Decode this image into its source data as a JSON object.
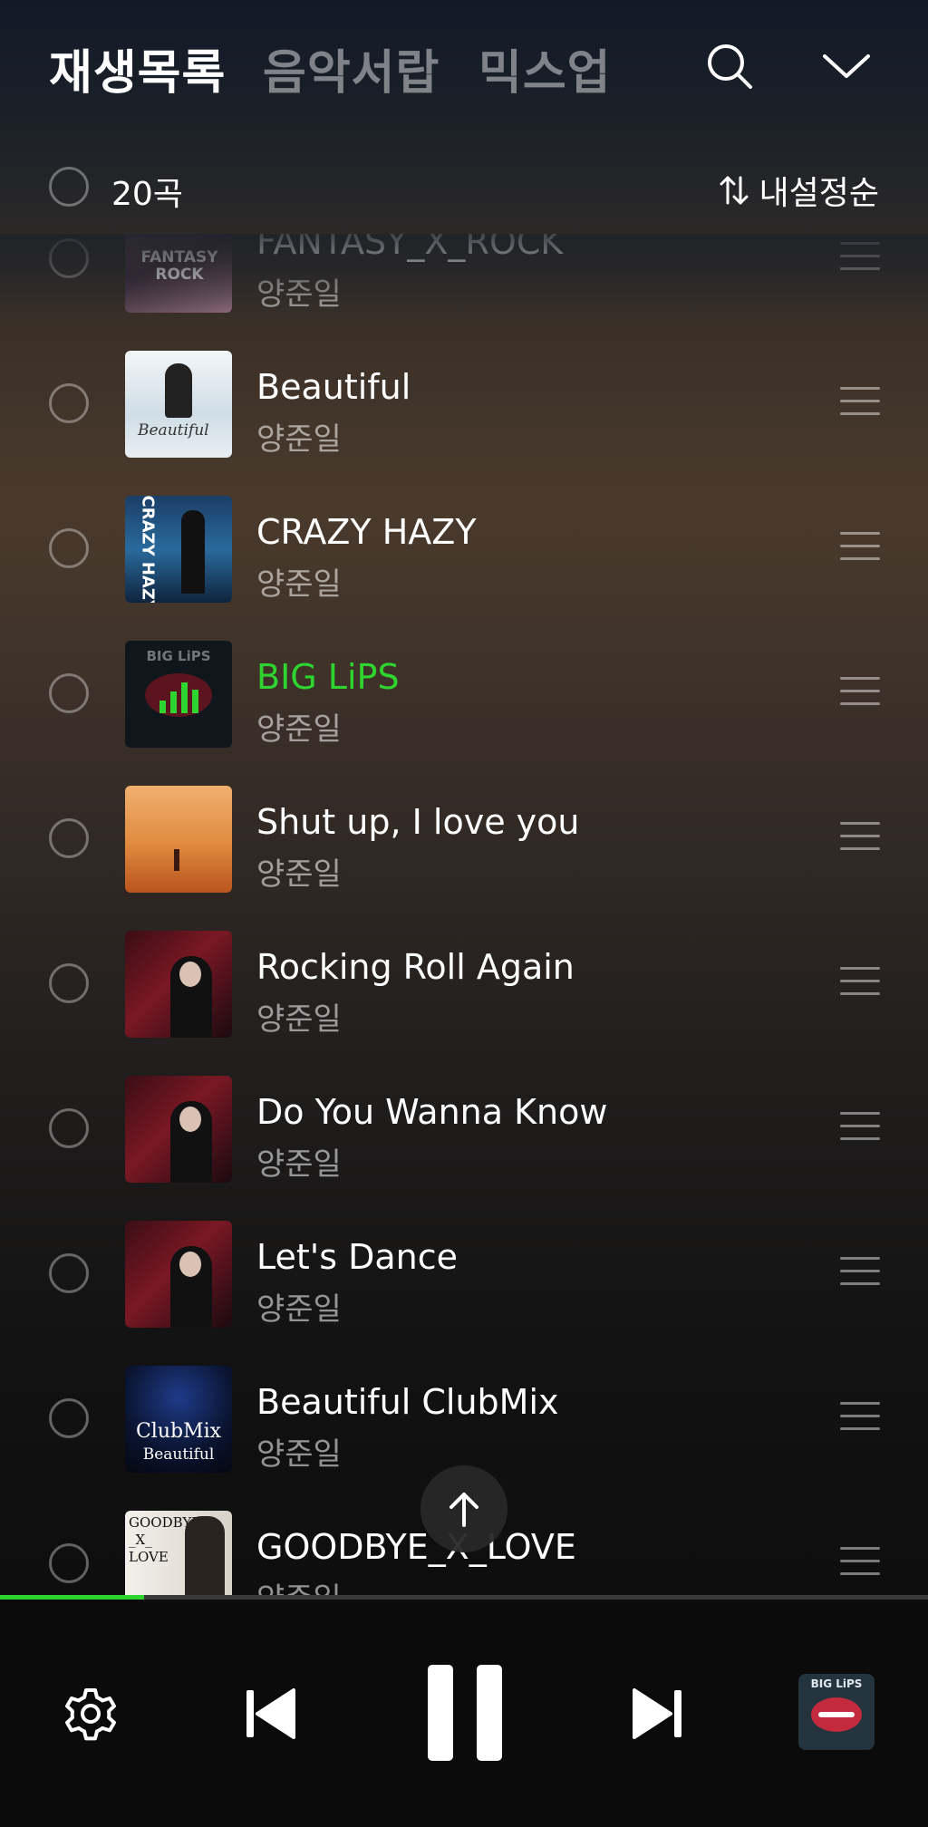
{
  "header": {
    "tabs": [
      {
        "label": "재생목록",
        "active": true
      },
      {
        "label": "음악서랍",
        "active": false
      },
      {
        "label": "믹스업",
        "active": false
      }
    ],
    "search_icon": "search-icon",
    "collapse_icon": "chevron-down-icon"
  },
  "subbar": {
    "count": "20곡",
    "sort_label": "내설정순",
    "sort_icon": "sort-arrows-icon"
  },
  "tracks": [
    {
      "title": "FANTASY_X_ROCK",
      "artist": "양준일",
      "playing": false
    },
    {
      "title": "Beautiful",
      "artist": "양준일",
      "playing": false
    },
    {
      "title": "CRAZY HAZY",
      "artist": "양준일",
      "playing": false
    },
    {
      "title": "BIG LiPS",
      "artist": "양준일",
      "playing": true
    },
    {
      "title": "Shut up, I love you",
      "artist": "양준일",
      "playing": false
    },
    {
      "title": "Rocking Roll Again",
      "artist": "양준일",
      "playing": false
    },
    {
      "title": "Do You Wanna Know",
      "artist": "양준일",
      "playing": false
    },
    {
      "title": "Let's Dance",
      "artist": "양준일",
      "playing": false
    },
    {
      "title": "Beautiful ClubMix",
      "artist": "양준일",
      "playing": false
    },
    {
      "title": "GOODBYE_X_LOVE",
      "artist": "양준일",
      "playing": false
    }
  ],
  "album_art_text": {
    "fantasy": "FANTASY ROCK",
    "beautiful": "Beautiful",
    "crazy": "CRAZY HAZY",
    "biglips": "BIG LiPS",
    "clubmix_1": "ClubMix",
    "clubmix_2": "Beautiful",
    "goodbye": "GOODBYE _X_ LOVE"
  },
  "playback": {
    "progress_fraction": 0.155,
    "accent_color": "#2ed52e",
    "controls": [
      "gear-icon",
      "previous-icon",
      "pause-icon",
      "next-icon"
    ],
    "now_playing_art_label": "BIG LiPS"
  },
  "scroll_top_icon": "arrow-up-icon"
}
